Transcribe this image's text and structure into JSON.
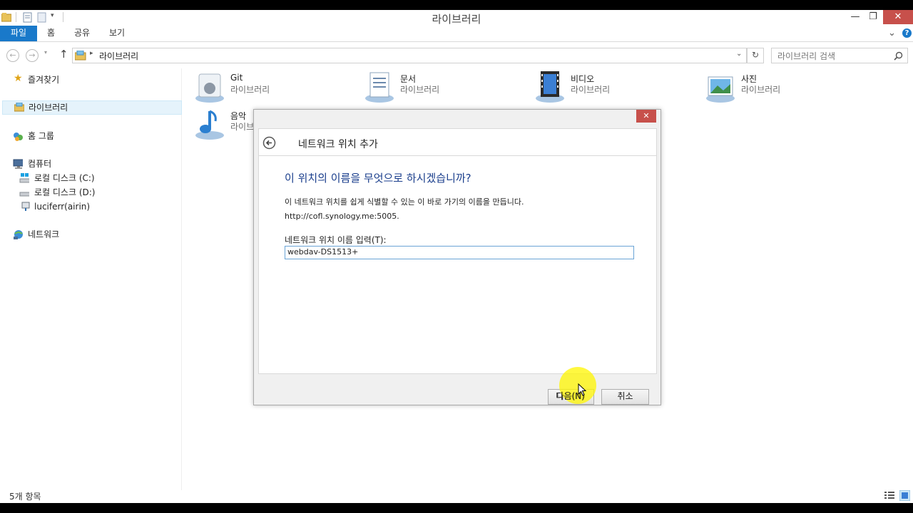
{
  "window": {
    "title": "라이브러리"
  },
  "titlebar": {
    "minimize_glyph": "—",
    "restore_glyph": "❐",
    "close_glyph": "✕"
  },
  "ribbon": {
    "tabs": [
      "파일",
      "홈",
      "공유",
      "보기"
    ],
    "expand_glyph": "⌄",
    "help_glyph": "?"
  },
  "address_bar": {
    "path_separator": "▸",
    "path": "라이브러리",
    "search_placeholder": "라이브러리 검색"
  },
  "sidebar": {
    "favorites": "즐겨찾기",
    "libraries": "라이브러리",
    "homegroup": "홈 그룹",
    "computer": "컴퓨터",
    "drive_c": "로컬 디스크 (C:)",
    "drive_d": "로컬 디스크 (D:)",
    "network_share": "luciferr(airin)",
    "network": "네트워크"
  },
  "libraries": [
    {
      "name": "Git",
      "type": "라이브러리"
    },
    {
      "name": "문서",
      "type": "라이브러리"
    },
    {
      "name": "비디오",
      "type": "라이브러리"
    },
    {
      "name": "사진",
      "type": "라이브러리"
    },
    {
      "name": "음악",
      "type": "라이브러리"
    }
  ],
  "status": {
    "item_count": "5개 항목"
  },
  "dialog": {
    "title": "네트워크 위치 추가",
    "heading": "이 위치의 이름을 무엇으로 하시겠습니까?",
    "description": "이 네트워크 위치를 쉽게 식별할 수 있는 이 바로 가기의 이름을 만듭니다.",
    "url": "http://cofl.synology.me:5005.",
    "field_label": "네트워크 위치 이름 입력(T):",
    "field_value": "webdav-DS1513+",
    "next_button": "다음(N)",
    "cancel_button": "취소",
    "close_glyph": "✕"
  },
  "colors": {
    "accent": "#1979ca",
    "dialog_heading": "#1a3e8c",
    "close_red": "#c7504b",
    "cursor_highlight": "#fff600"
  }
}
